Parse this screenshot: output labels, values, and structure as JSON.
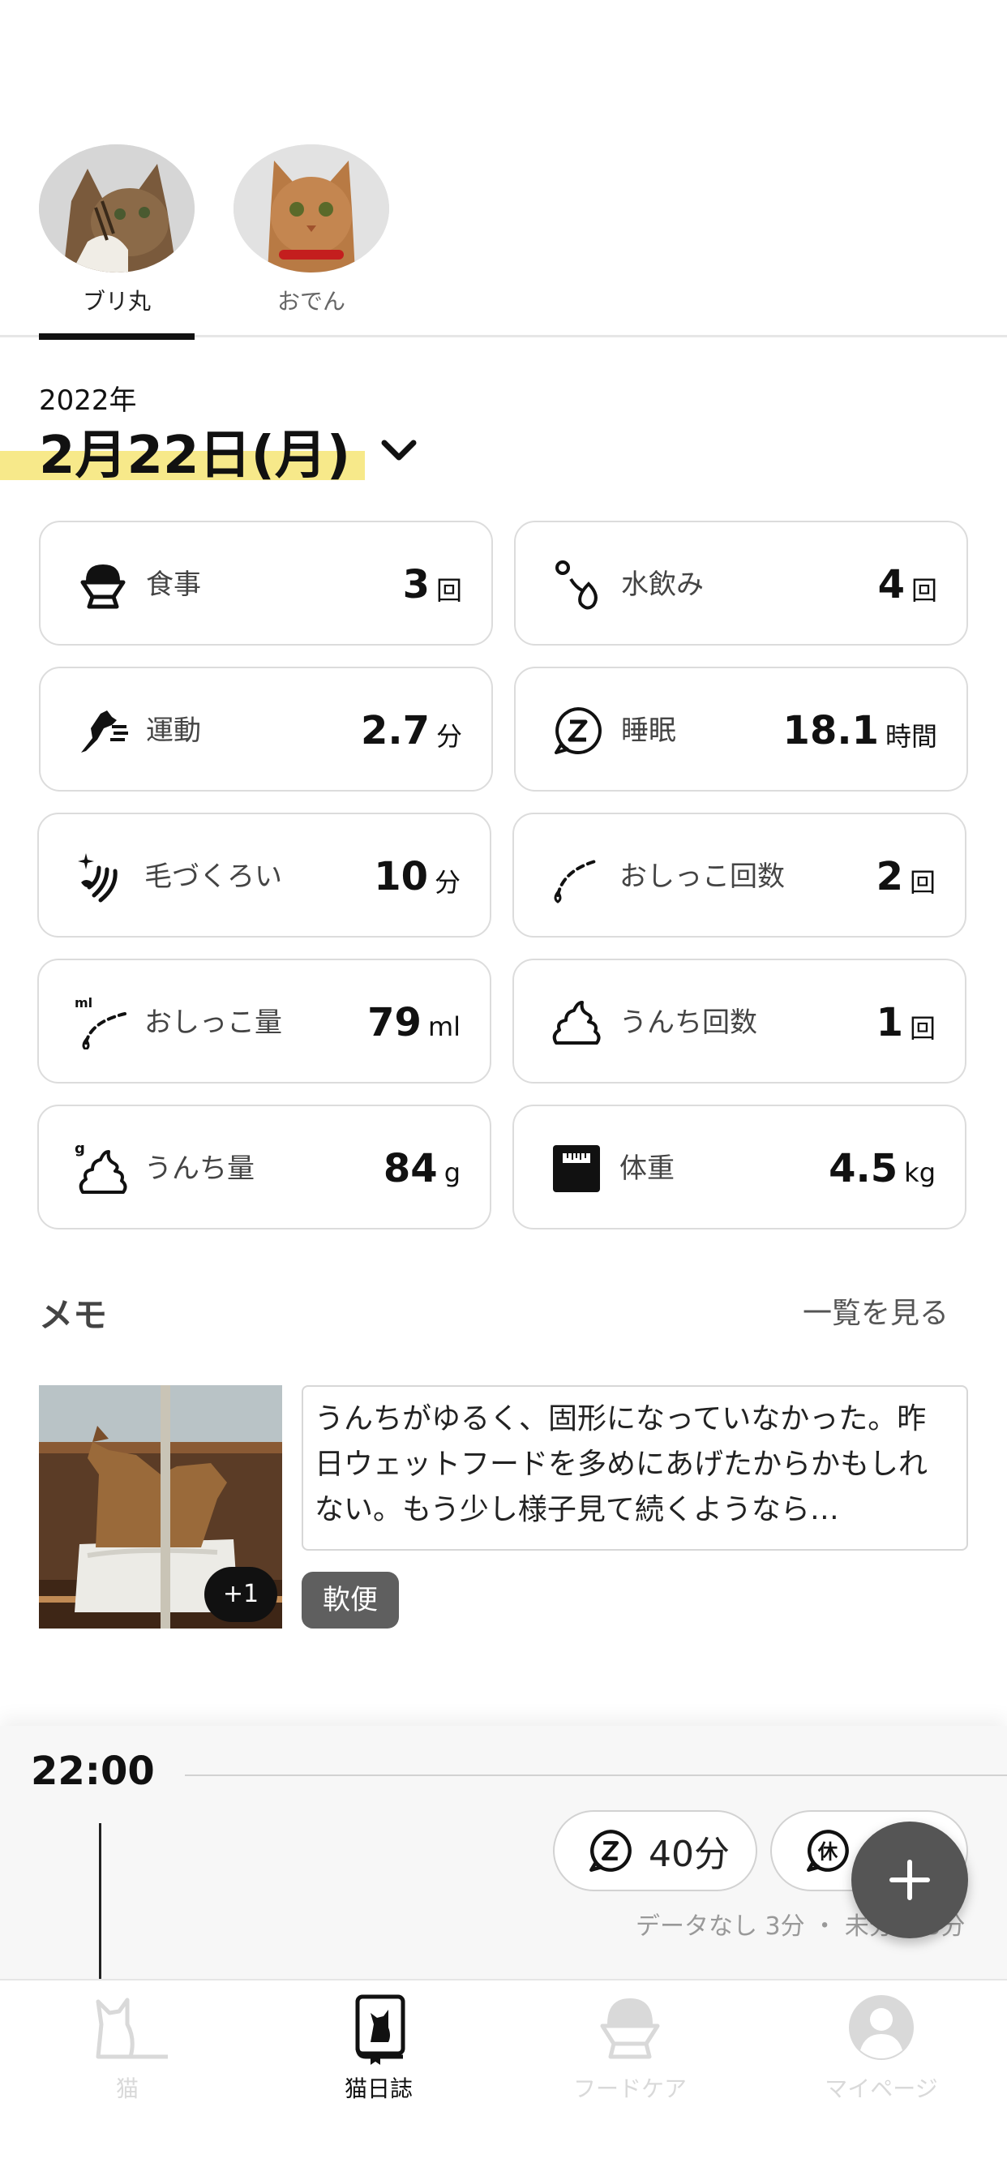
{
  "cats": [
    {
      "name": "ブリ丸",
      "selected": true
    },
    {
      "name": "おでん",
      "selected": false
    }
  ],
  "date": {
    "year": "2022年",
    "day": "2月22日(月)",
    "dropdown_icon": "chevron-down-icon"
  },
  "stats": [
    {
      "label": "食事",
      "value": "3",
      "unit": "回",
      "icon": "food-bowl-icon"
    },
    {
      "label": "水飲み",
      "value": "4",
      "unit": "回",
      "icon": "water-drop-icon"
    },
    {
      "label": "運動",
      "value": "2.7",
      "unit": "分",
      "icon": "running-cat-icon"
    },
    {
      "label": "睡眠",
      "value": "18.1",
      "unit": "時間",
      "icon": "sleep-icon"
    },
    {
      "label": "毛づくろい",
      "value": "10",
      "unit": "分",
      "icon": "grooming-icon"
    },
    {
      "label": "おしっこ回数",
      "value": "2",
      "unit": "回",
      "icon": "pee-icon"
    },
    {
      "label": "おしっこ量",
      "value": "79",
      "unit": "ml",
      "icon": "pee-volume-icon"
    },
    {
      "label": "うんち回数",
      "value": "1",
      "unit": "回",
      "icon": "poop-icon"
    },
    {
      "label": "うんち量",
      "value": "84",
      "unit": "g",
      "icon": "poop-weight-icon"
    },
    {
      "label": "体重",
      "value": "4.5",
      "unit": "kg",
      "icon": "scale-icon"
    }
  ],
  "memo": {
    "title": "メモ",
    "view_all": "一覧を見る",
    "photo_count": "+1",
    "text": "うんちがゆるく、固形になっていなかった。昨日ウェットフードを多めにあげたからかもしれない。もう少し様子見て続くようなら…",
    "tag": "軟便"
  },
  "timeline": {
    "time": "22:00",
    "pills": [
      {
        "icon": "sleep-icon",
        "text": "40分"
      },
      {
        "icon": "rest-icon",
        "text": ""
      }
    ],
    "subtext": "データなし 3分 ・ 未分類 3分"
  },
  "fab_icon": "plus-icon",
  "nav": [
    {
      "label": "猫",
      "icon": "cat-icon",
      "active": false
    },
    {
      "label": "猫日誌",
      "icon": "diary-icon",
      "active": true
    },
    {
      "label": "フードケア",
      "icon": "food-care-icon",
      "active": false
    },
    {
      "label": "マイページ",
      "icon": "user-icon",
      "active": false
    }
  ]
}
